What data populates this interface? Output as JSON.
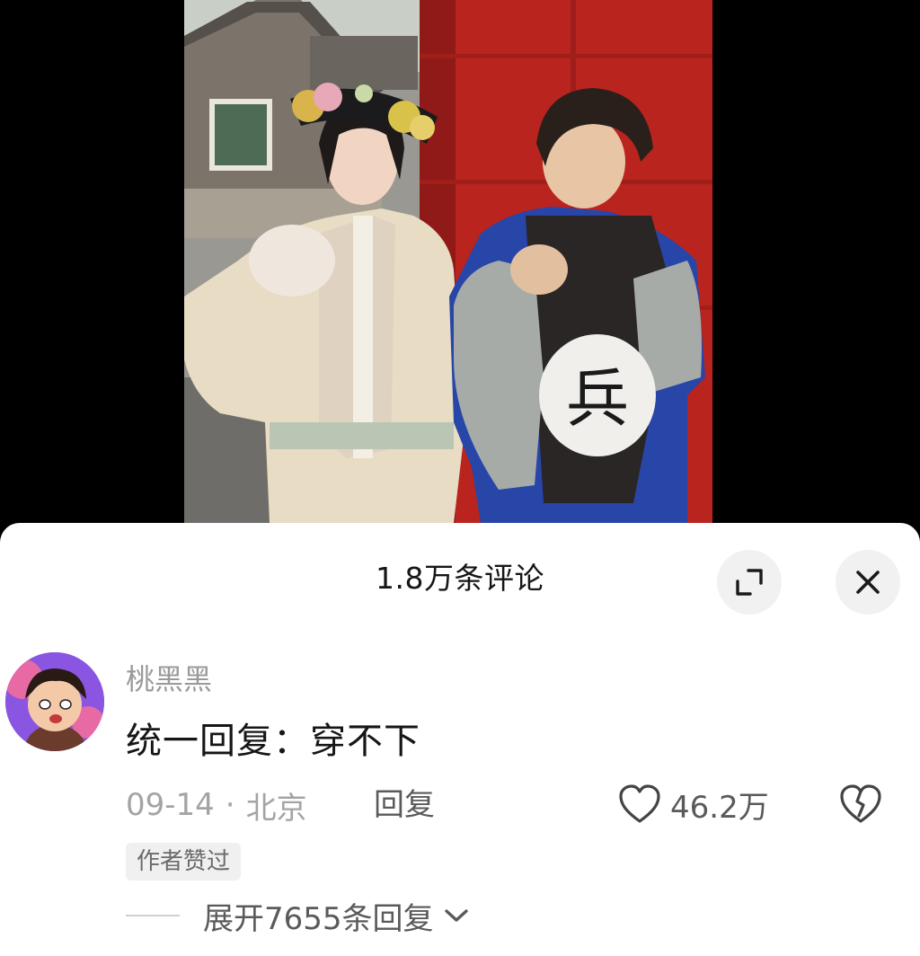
{
  "video": {
    "costume_character": "兵"
  },
  "comments_sheet": {
    "title": "1.8万条评论",
    "expand_icon": "expand-icon",
    "close_icon": "close-icon"
  },
  "comment": {
    "username": "桃黑黑",
    "text": "统一回复：穿不下",
    "date": "09-14",
    "separator": "·",
    "location": "北京",
    "reply_label": "回复",
    "like_count": "46.2万",
    "author_badge": "作者赞过",
    "expand_replies": "展开7655条回复"
  },
  "colors": {
    "sheet_bg": "#ffffff",
    "primary_text": "#161616",
    "secondary_text": "#a4a4a4",
    "button_bg": "#f1f1f2"
  }
}
